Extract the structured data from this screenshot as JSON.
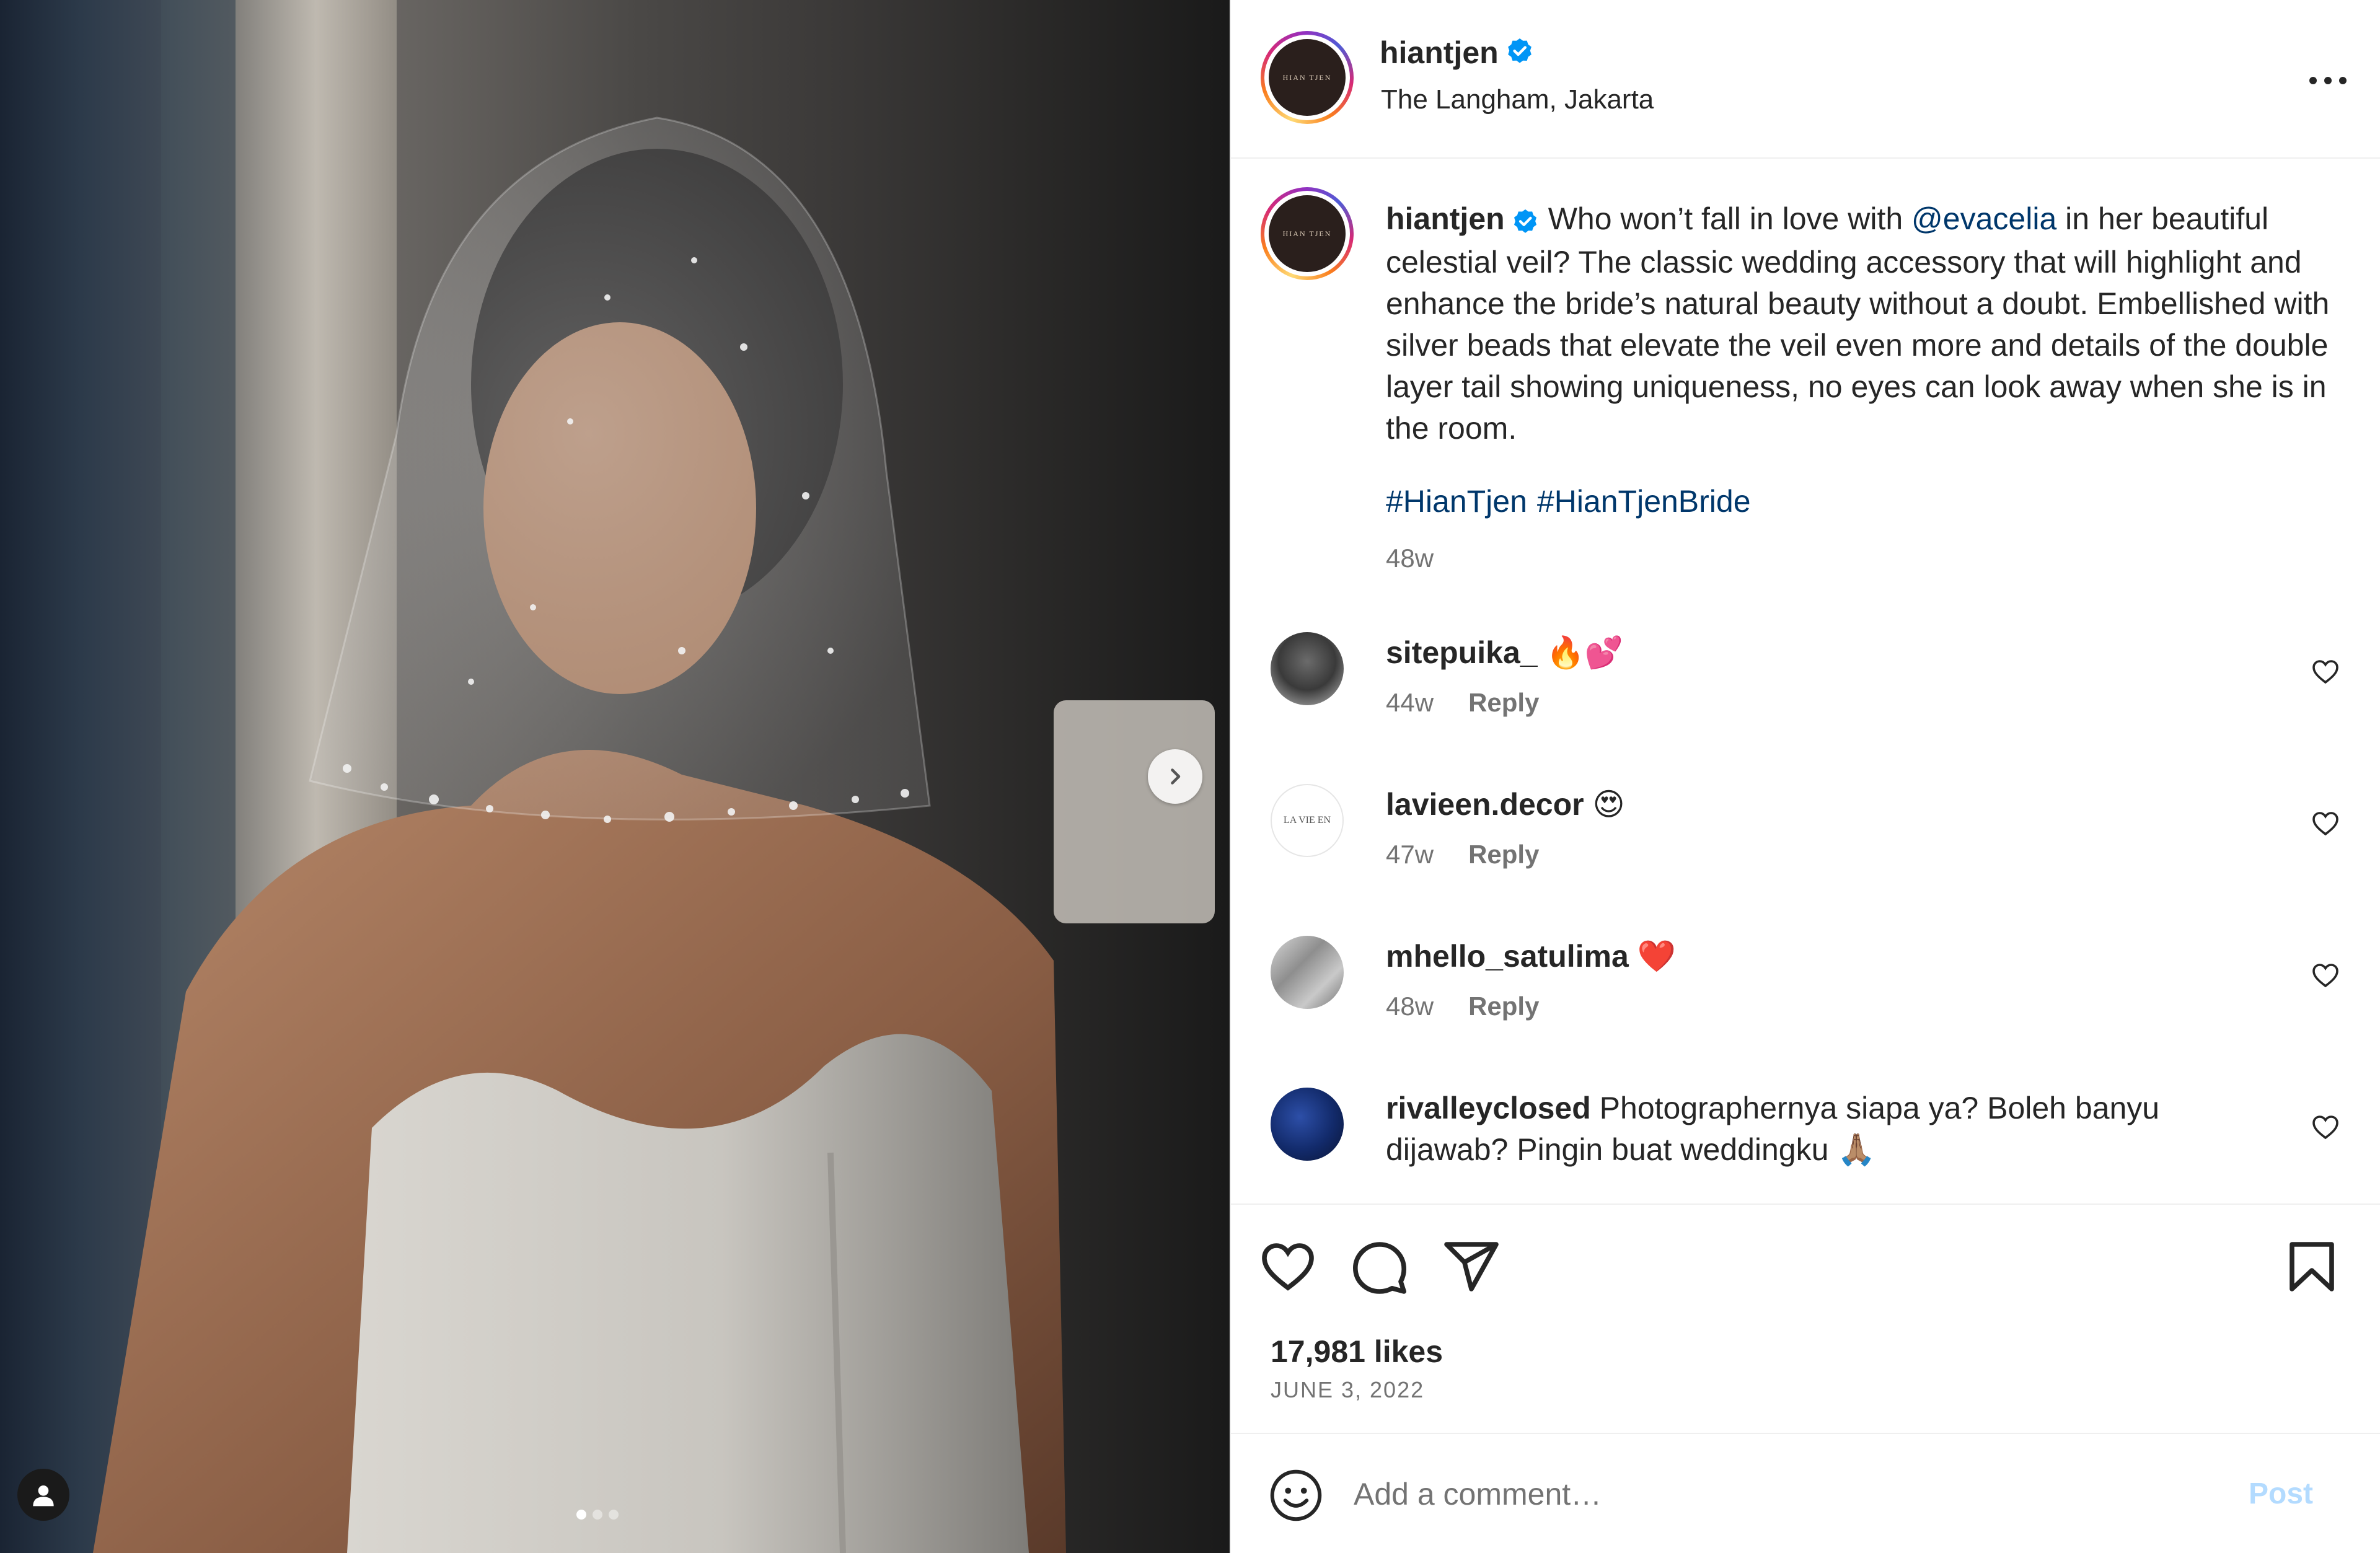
{
  "post": {
    "username": "hiantjen",
    "location": "The Langham, Jakarta",
    "avatar_text": "HIAN TJEN",
    "caption": {
      "username": "hiantjen",
      "text_before_mention": "Who won’t fall in love with ",
      "mention": "@evacelia",
      "text_after_mention": " in her beautiful celestial veil? The classic wedding accessory that will highlight and enhance the bride’s natural beauty without a doubt. Embellished with silver beads that elevate the veil even more and details of the double layer tail showing uniqueness, no eyes can look away when she is in the room.",
      "hashtags": [
        "#HianTjen",
        "#HianTjenBride"
      ],
      "time": "48w"
    },
    "comments": [
      {
        "username": "sitepuika_",
        "text": "🔥💕",
        "time": "44w",
        "reply": "Reply"
      },
      {
        "username": "lavieen.decor",
        "text": "😍",
        "time": "47w",
        "reply": "Reply",
        "avatar_text": "LA VIE EN"
      },
      {
        "username": "mhello_satulima",
        "text": "❤️",
        "time": "48w",
        "reply": "Reply"
      },
      {
        "username": "rivalleyclosed",
        "text": "Photographernya siapa ya? Boleh banyu dijawab? Pingin buat weddingku 🙏🏽",
        "time": "",
        "reply": ""
      }
    ],
    "likes": "17,981 likes",
    "date": "JUNE 3, 2022",
    "comment_placeholder": "Add a comment…",
    "post_button": "Post"
  },
  "carousel": {
    "count": 3,
    "active": 0
  },
  "colors": {
    "link": "#00376b",
    "secondary_text": "#737373",
    "verified": "#0095f6",
    "post_button_disabled": "#b3dbff"
  },
  "icons": {
    "verified": "verified-badge-icon",
    "more": "more-horizontal-icon",
    "next": "chevron-right-icon",
    "user_tag": "person-icon",
    "like": "heart-icon",
    "comment": "speech-bubble-icon",
    "share": "paper-plane-icon",
    "save": "bookmark-icon",
    "emoji": "smiley-icon"
  }
}
